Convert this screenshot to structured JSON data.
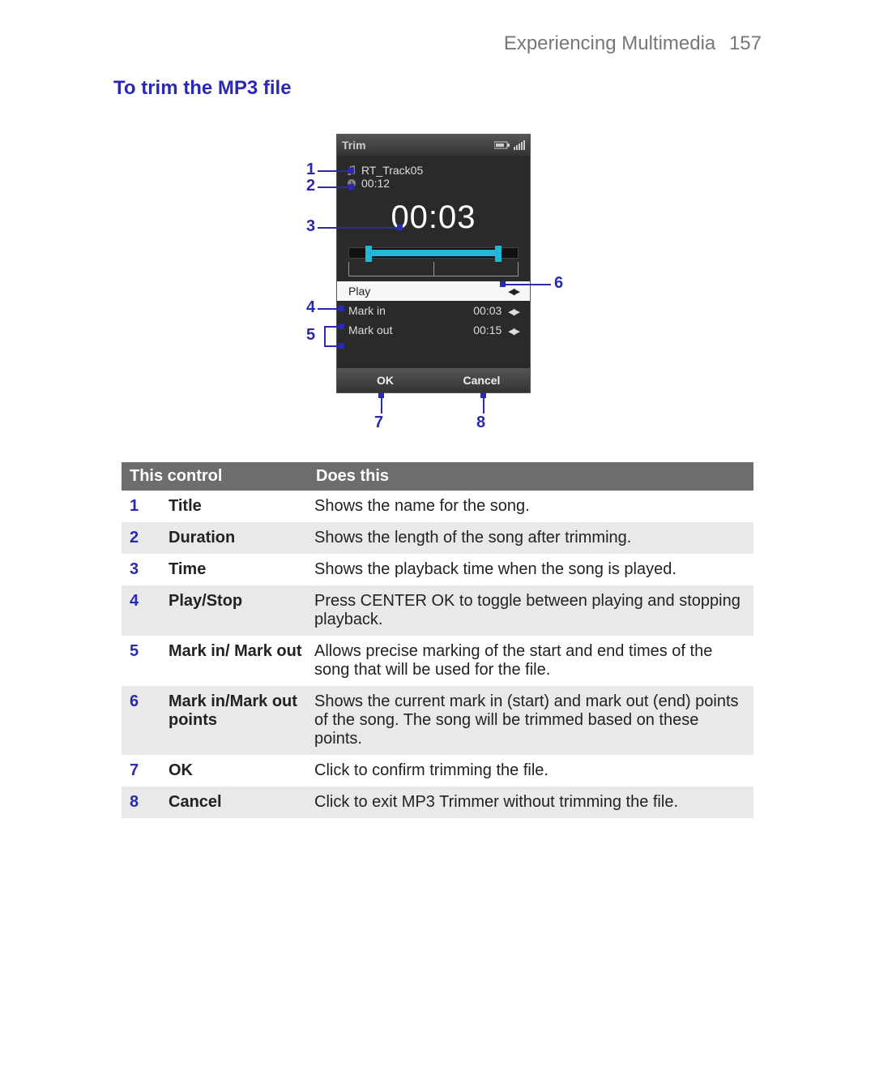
{
  "page": {
    "chapter": "Experiencing Multimedia",
    "number": "157",
    "section_title": "To trim the MP3 file"
  },
  "phone": {
    "title": "Trim",
    "track_name": "RT_Track05",
    "duration": "00:12",
    "play_time": "00:03",
    "rows": {
      "play": "Play",
      "mark_in_label": "Mark in",
      "mark_in_value": "00:03",
      "mark_out_label": "Mark out",
      "mark_out_value": "00:15"
    },
    "ok": "OK",
    "cancel": "Cancel"
  },
  "callouts": {
    "c1": "1",
    "c2": "2",
    "c3": "3",
    "c4": "4",
    "c5": "5",
    "c6": "6",
    "c7": "7",
    "c8": "8"
  },
  "table": {
    "header_control": "This control",
    "header_does": "Does this",
    "rows": [
      {
        "n": "1",
        "name": "Title",
        "desc": "Shows the name for the song."
      },
      {
        "n": "2",
        "name": "Duration",
        "desc": "Shows the length of the song after trimming."
      },
      {
        "n": "3",
        "name": "Time",
        "desc": "Shows the playback time when the song is played."
      },
      {
        "n": "4",
        "name": "Play/Stop",
        "desc": "Press CENTER OK to toggle between playing and stopping playback."
      },
      {
        "n": "5",
        "name": "Mark in/ Mark out",
        "desc": "Allows precise marking of the start and end times of the song that will be used for the file."
      },
      {
        "n": "6",
        "name": "Mark in/Mark out points",
        "desc": "Shows the current mark in (start) and mark out (end) points of the song. The song will be trimmed based on these points."
      },
      {
        "n": "7",
        "name": "OK",
        "desc": "Click to confirm trimming the file."
      },
      {
        "n": "8",
        "name": "Cancel",
        "desc": "Click to exit MP3 Trimmer without trimming the file."
      }
    ]
  }
}
